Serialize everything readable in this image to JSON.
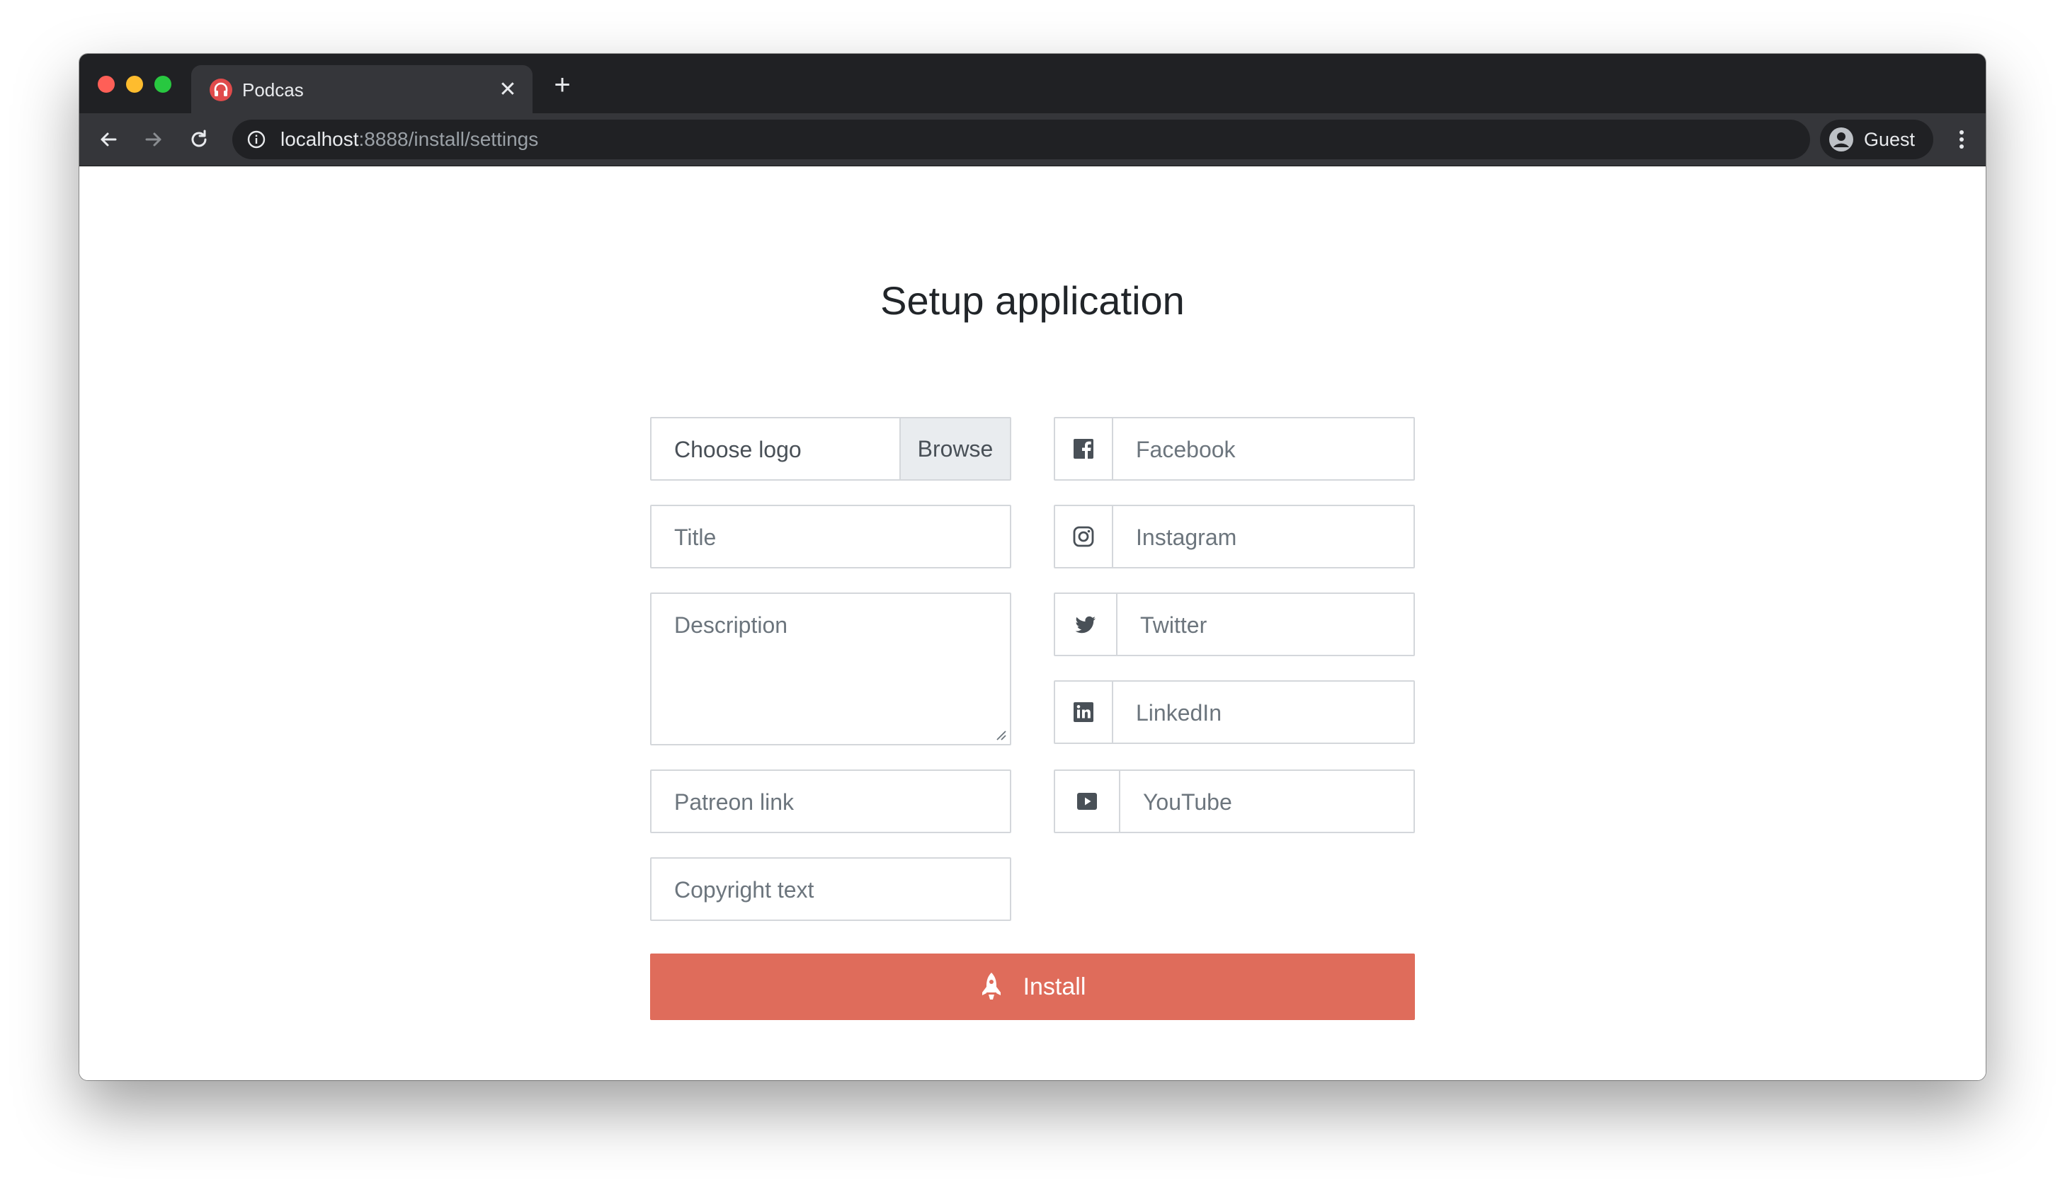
{
  "browser": {
    "tab": {
      "title": "Podcas",
      "favicon": "headphones-icon",
      "close_glyph": "✕"
    },
    "new_tab_glyph": "+",
    "address": {
      "host": "localhost",
      "path": ":8888/install/settings"
    },
    "profile_label": "Guest"
  },
  "page": {
    "title": "Setup application",
    "form": {
      "logo": {
        "placeholder": "Choose logo",
        "browse_label": "Browse"
      },
      "title_placeholder": "Title",
      "description_placeholder": "Description",
      "patreon_placeholder": "Patreon link",
      "copyright_placeholder": "Copyright text",
      "social": [
        {
          "icon": "facebook-icon",
          "placeholder": "Facebook"
        },
        {
          "icon": "instagram-icon",
          "placeholder": "Instagram"
        },
        {
          "icon": "twitter-icon",
          "placeholder": "Twitter"
        },
        {
          "icon": "linkedin-icon",
          "placeholder": "LinkedIn"
        },
        {
          "icon": "youtube-icon",
          "placeholder": "YouTube"
        }
      ],
      "install_label": "Install",
      "install_icon": "rocket-icon"
    }
  },
  "colors": {
    "accent": "#df6c5b",
    "chrome_dark": "#202124",
    "chrome_toolbar": "#35363a",
    "field_border": "#d4d7db",
    "placeholder_text": "#6c757d"
  }
}
